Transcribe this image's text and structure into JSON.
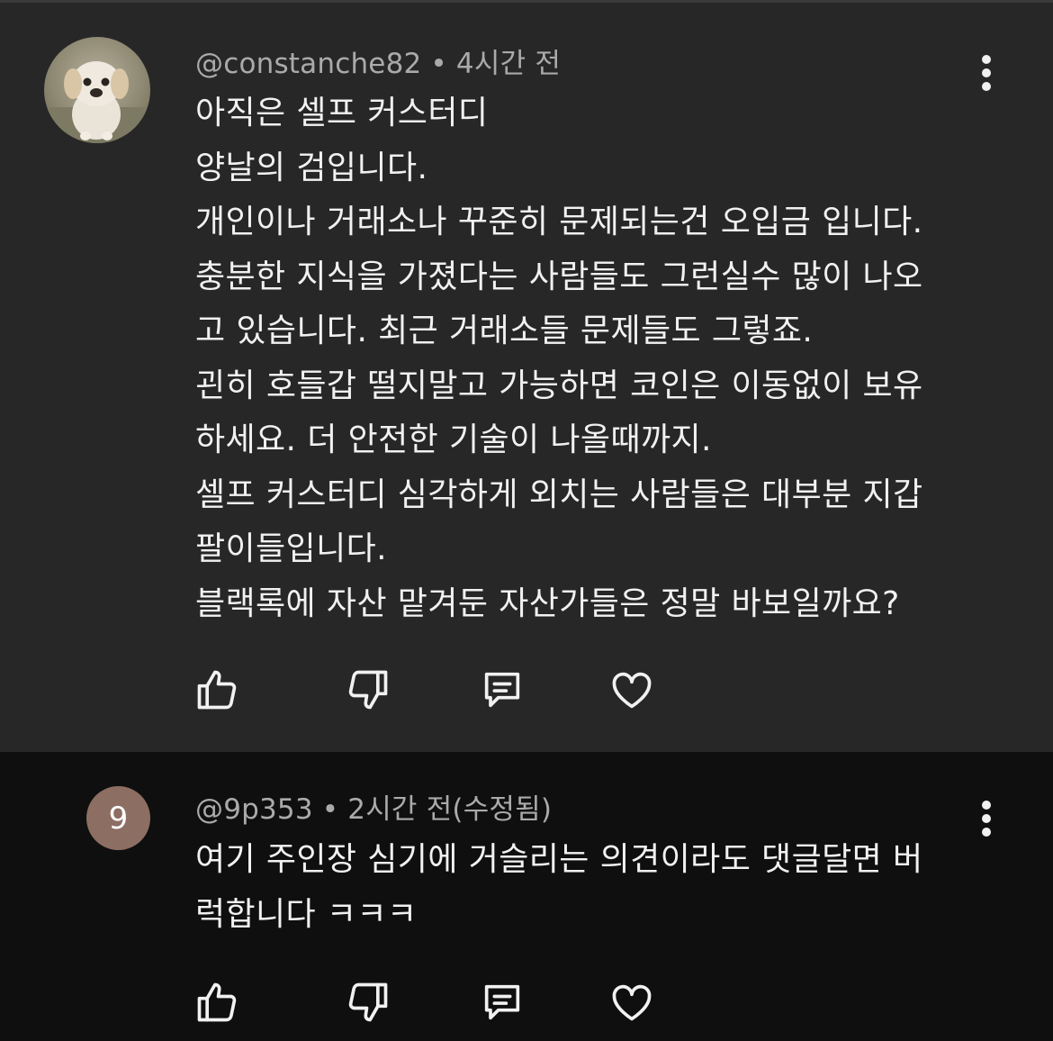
{
  "comments": [
    {
      "author": "@constanche82",
      "separator": "•",
      "time": "4시간 전",
      "avatar": {
        "type": "photo",
        "description_icon": "dog-avatar"
      },
      "text": "아직은 셀프 커스터디\n양날의 검입니다.\n개인이나 거래소나 꾸준히 문제되는건 오입금 입니다.\n충분한 지식을 가졌다는 사람들도 그런실수 많이 나오\n고 있습니다. 최근 거래소들 문제들도 그렇죠.\n괸히 호들갑 떨지말고 가능하면 코인은 이동없이 보유\n하세요. 더 안전한 기술이 나올때까지.\n셀프 커스터디 심각하게 외치는 사람들은 대부분 지갑\n팔이들입니다.\n블랙록에 자산 맡겨둔 자산가들은 정말 바보일까요?",
      "actions": [
        "like-icon",
        "dislike-icon",
        "reply-icon",
        "heart-icon"
      ]
    },
    {
      "author": "@9p353",
      "separator": "•",
      "time": "2시간 전(수정됨)",
      "avatar": {
        "type": "letter",
        "letter": "9",
        "color": "#8d6e63"
      },
      "text": "여기 주인장 심기에 거슬리는 의견이라도 댓글달면 버\n럭합니다 ㅋㅋㅋ",
      "actions": [
        "like-icon",
        "dislike-icon",
        "reply-icon",
        "heart-icon"
      ]
    }
  ],
  "colors": {
    "highlight_bg": "#272727",
    "page_bg": "#0f0f0f",
    "text": "#f1f1f1",
    "meta": "#aaaaaa",
    "avatar_letter_bg": "#8d6e63"
  }
}
